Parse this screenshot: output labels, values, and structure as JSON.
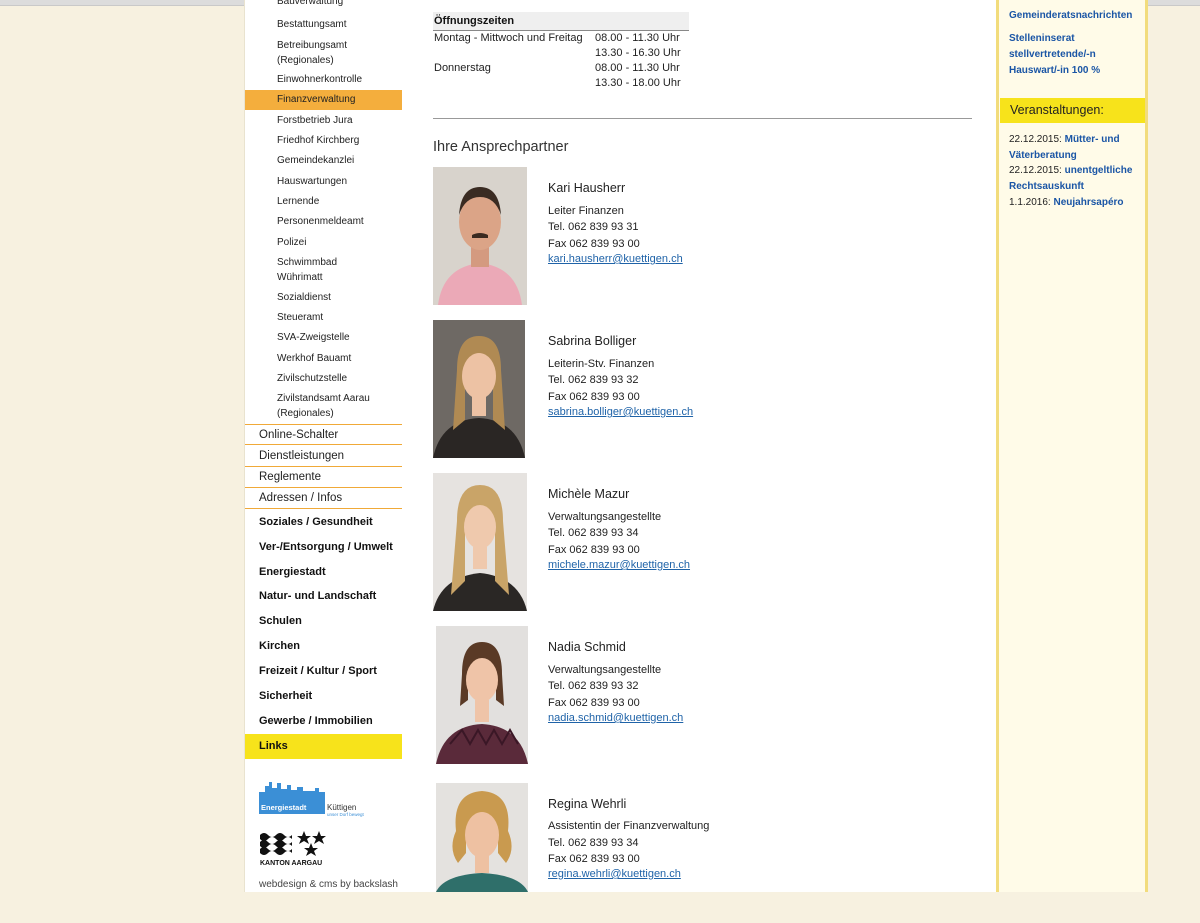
{
  "sidebar": {
    "sub_items": [
      "Bauverwaltung",
      "Bestattungsamt",
      "Betreibungsamt (Regionales)",
      "Einwohnerkontrolle",
      "Finanzverwaltung",
      "Forstbetrieb Jura",
      "Friedhof Kirchberg",
      "Gemeindekanzlei",
      "Hauswartungen",
      "Lernende",
      "Personenmeldeamt",
      "Polizei",
      "Schwimmbad Wührimatt",
      "Sozialdienst",
      "Steueramt",
      "SVA-Zweigstelle",
      "Werkhof Bauamt",
      "Zivilschutzstelle",
      "Zivilstandsamt Aarau (Regionales)"
    ],
    "active_item": "Finanzverwaltung",
    "sections": [
      "Online-Schalter",
      "Dienstleistungen",
      "Reglemente",
      "Adressen / Infos"
    ],
    "main_items": [
      "Soziales / Gesundheit",
      "Ver-/Entsorgung / Umwelt",
      "Energiestadt",
      "Natur- und Landschaft",
      "Schulen",
      "Kirchen",
      "Freizeit / Kultur / Sport",
      "Sicherheit",
      "Gewerbe / Immobilien",
      "Links"
    ],
    "highlight_item": "Links",
    "energie_logo": {
      "brand": "Energiestadt",
      "town": "Küttigen",
      "tagline": "unser Dorf bewegt"
    },
    "aargau_logo": "KANTON AARGAU",
    "credit": "webdesign & cms by backslash"
  },
  "oeffnungszeiten": {
    "title": "Öffnungszeiten",
    "rows": [
      {
        "label": "Montag - Mittwoch und Freitag",
        "times": [
          "08.00 - 11.30 Uhr",
          "13.30 - 16.30 Uhr"
        ]
      },
      {
        "label": "Donnerstag",
        "times": [
          "08.00 - 11.30 Uhr",
          "13.30 - 18.00 Uhr"
        ]
      }
    ]
  },
  "contacts": {
    "title": "Ihre Ansprechpartner",
    "people": [
      {
        "name": "Kari Hausherr",
        "role": "Leiter Finanzen",
        "tel": "Tel. 062 839 93 31",
        "fax": "Fax 062 839 93 00",
        "email": "kari.hausherr@kuettigen.ch"
      },
      {
        "name": "Sabrina Bolliger",
        "role": "Leiterin-Stv. Finanzen",
        "tel": "Tel. 062 839 93 32",
        "fax": "Fax 062 839 93 00",
        "email": "sabrina.bolliger@kuettigen.ch"
      },
      {
        "name": "Michèle Mazur",
        "role": "Verwaltungsangestellte",
        "tel": "Tel. 062 839 93 34",
        "fax": "Fax 062 839 93 00",
        "email": "michele.mazur@kuettigen.ch"
      },
      {
        "name": "Nadia Schmid",
        "role": "Verwaltungsangestellte",
        "tel": "Tel. 062 839 93 32",
        "fax": "Fax 062 839 93 00",
        "email": "nadia.schmid@kuettigen.ch"
      },
      {
        "name": "Regina Wehrli",
        "role": "Assistentin der Finanzverwaltung",
        "tel": "Tel. 062 839 93 34",
        "fax": "Fax 062 839 93 00",
        "email": "regina.wehrli@kuettigen.ch"
      }
    ]
  },
  "right": {
    "news_link": "Gemeinderatsnachrichten",
    "job_link": "Stelleninserat stellvertretende/-n Hauswart/-in 100 %",
    "events_title": "Veranstaltungen:",
    "events": [
      {
        "date": "22.12.2015:",
        "title": "Mütter- und Väterberatung"
      },
      {
        "date": "22.12.2015:",
        "title": "unentgeltliche Rechtsauskunft"
      },
      {
        "date": "1.1.2016:",
        "title": "Neujahrsapéro"
      }
    ]
  },
  "colors": {
    "active": "#f4ae3d",
    "highlight": "#f7e31b",
    "link": "#1a55a5",
    "email": "#1f63a8",
    "page_bg": "#f7f1e0"
  }
}
